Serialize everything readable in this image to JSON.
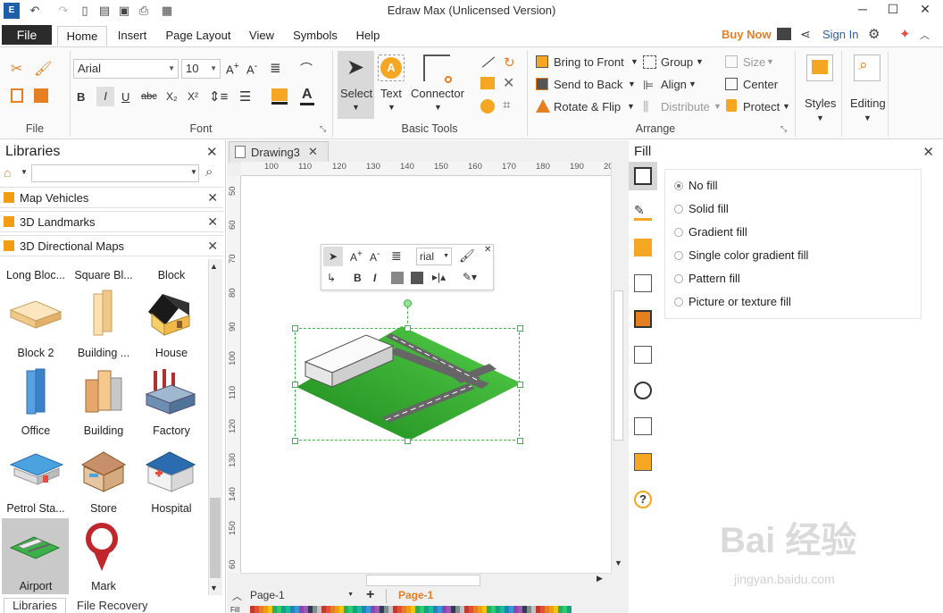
{
  "window": {
    "title": "Edraw Max (Unlicensed Version)"
  },
  "tabs": {
    "file": "File",
    "items": [
      "Home",
      "Insert",
      "Page Layout",
      "View",
      "Symbols",
      "Help"
    ],
    "active": "Home",
    "buy_now": "Buy Now",
    "sign_in": "Sign In"
  },
  "ribbon": {
    "file_group": "File",
    "font_group": "Font",
    "font_name": "Arial",
    "font_size": "10",
    "basic_tools_group": "Basic Tools",
    "select": "Select",
    "text": "Text",
    "connector": "Connector",
    "arrange_group": "Arrange",
    "bring_to_front": "Bring to Front",
    "send_to_back": "Send to Back",
    "rotate_flip": "Rotate & Flip",
    "group": "Group",
    "align": "Align",
    "distribute": "Distribute",
    "size": "Size",
    "center": "Center",
    "protect": "Protect",
    "styles": "Styles",
    "editing": "Editing",
    "accent": "#f5a623"
  },
  "libraries": {
    "title": "Libraries",
    "search_placeholder": "",
    "sections": [
      "Map Vehicles",
      "3D Landmarks",
      "3D Directional Maps"
    ],
    "shapes": [
      [
        "Long Bloc...",
        "Square Bl...",
        "Block"
      ],
      [
        "Block 2",
        "Building ...",
        "House"
      ],
      [
        "Office",
        "Building",
        "Factory"
      ],
      [
        "Petrol Sta...",
        "Store",
        "Hospital"
      ],
      [
        "Airport",
        "Mark"
      ]
    ],
    "bottom_tabs": [
      "Libraries",
      "File Recovery"
    ]
  },
  "canvas": {
    "doc_tab": "Drawing3",
    "ruler_h": [
      "100",
      "110",
      "120",
      "130",
      "140",
      "150",
      "160",
      "170",
      "180",
      "190",
      "20"
    ],
    "ruler_v": [
      "50",
      "60",
      "70",
      "80",
      "90",
      "100",
      "110",
      "120",
      "130",
      "140",
      "150",
      "60"
    ],
    "page_selector": "Page-1",
    "page_tab": "Page-1",
    "mini_font": "rial",
    "fill_label": "Fill"
  },
  "fill": {
    "title": "Fill",
    "options": [
      "No fill",
      "Solid fill",
      "Gradient fill",
      "Single color gradient fill",
      "Pattern fill",
      "Picture or texture fill"
    ],
    "selected": "No fill"
  },
  "watermark": {
    "logo": "Bai 经验",
    "url": "jingyan.baidu.com"
  }
}
